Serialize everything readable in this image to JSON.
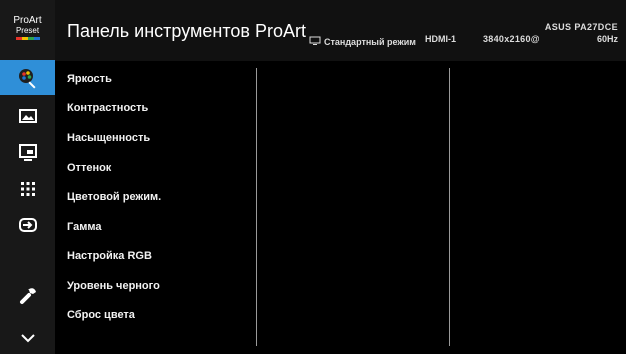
{
  "logo": {
    "line1": "ProArt",
    "line2": "Preset"
  },
  "sidebar": {
    "items": [
      {
        "icon": "proart-palette-icon"
      },
      {
        "icon": "image-icon"
      },
      {
        "icon": "picture-in-picture-icon"
      },
      {
        "icon": "grid-icon"
      },
      {
        "icon": "input-select-icon"
      },
      {
        "icon": "wrench-icon"
      },
      {
        "icon": "chevron-down-icon"
      }
    ]
  },
  "header": {
    "title": "Панель инструментов ProArt",
    "mode_label": "Стандартный режим",
    "input": "HDMI-1",
    "model": "ASUS PA27DCE",
    "resolution": "3840x2160@",
    "refresh": "60Hz"
  },
  "menu": {
    "items": [
      "Яркость",
      "Контрастность",
      "Насыщенность",
      "Оттенок",
      "Цветовой режим.",
      "Гамма",
      "Настройка RGB",
      "Уровень черного",
      "Сброс цвета"
    ]
  },
  "colors": {
    "accent": "#2f8fd8",
    "header_bg": "#111111",
    "content_bg": "#000000",
    "divider": "#9a9a9a"
  }
}
